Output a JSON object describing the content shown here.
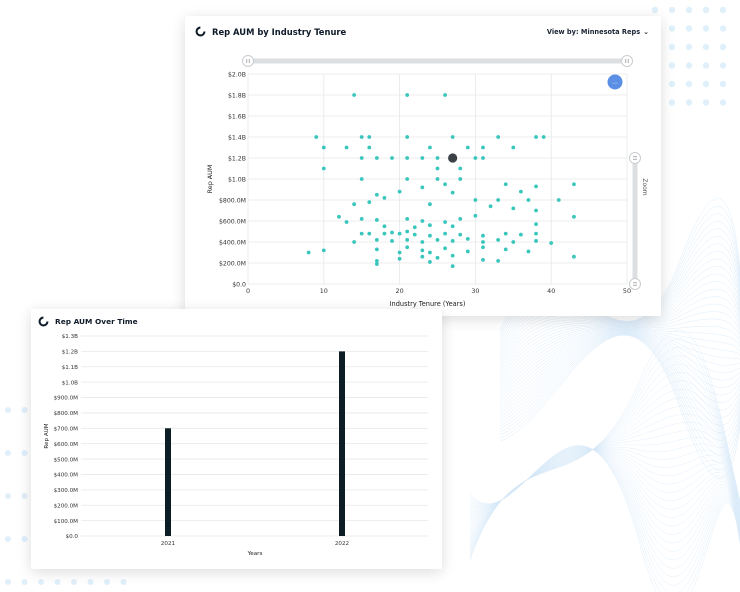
{
  "colors": {
    "scatter_point": "#39c6bc",
    "highlight_point": "#3b4147",
    "bar": "#0c1d26",
    "grid": "#e6e8ea",
    "menu_button": "#5b8fe6",
    "decor_dots": "#e0f0fb"
  },
  "scatter_card": {
    "title": "Rep AUM by Industry Tenure",
    "view_by_label": "View by: Minnesota Reps",
    "zoom_label": "Zoom",
    "menu_icon": "ellipsis-icon"
  },
  "bar_card": {
    "title": "Rep AUM Over Time"
  },
  "chart_data": [
    {
      "type": "scatter",
      "title": "Rep AUM by Industry Tenure",
      "xlabel": "Industry Tenure (Years)",
      "ylabel": "Rep AUM",
      "xlim": [
        0,
        50
      ],
      "ylim": [
        0,
        2000000000
      ],
      "x_ticks": [
        "0",
        "10",
        "20",
        "30",
        "40",
        "50"
      ],
      "y_ticks": [
        "$0.0",
        "$200.0M",
        "$400.0M",
        "$600.0M",
        "$800.0M",
        "$1.0B",
        "$1.2B",
        "$1.4B",
        "$1.6B",
        "$1.8B",
        "$2.0B"
      ],
      "grid": true,
      "highlight": {
        "x": 27,
        "y": 1200000000
      },
      "points": [
        [
          14,
          1800000000
        ],
        [
          21,
          1800000000
        ],
        [
          26,
          1800000000
        ],
        [
          9,
          1400000000
        ],
        [
          15,
          1400000000
        ],
        [
          16,
          1400000000
        ],
        [
          21,
          1400000000
        ],
        [
          27,
          1400000000
        ],
        [
          33,
          1400000000
        ],
        [
          38,
          1400000000
        ],
        [
          39,
          1400000000
        ],
        [
          10,
          1300000000
        ],
        [
          13,
          1300000000
        ],
        [
          16,
          1300000000
        ],
        [
          24,
          1300000000
        ],
        [
          29,
          1300000000
        ],
        [
          31,
          1300000000
        ],
        [
          35,
          1300000000
        ],
        [
          15,
          1200000000
        ],
        [
          17,
          1200000000
        ],
        [
          19,
          1200000000
        ],
        [
          21,
          1200000000
        ],
        [
          23,
          1200000000
        ],
        [
          25,
          1200000000
        ],
        [
          30,
          1200000000
        ],
        [
          31,
          1200000000
        ],
        [
          10,
          1100000000
        ],
        [
          25,
          1100000000
        ],
        [
          28,
          1100000000
        ],
        [
          15,
          1000000000
        ],
        [
          21,
          1000000000
        ],
        [
          25,
          1000000000
        ],
        [
          28,
          1000000000
        ],
        [
          17,
          850000000
        ],
        [
          18,
          820000000
        ],
        [
          23,
          920000000
        ],
        [
          26,
          950000000
        ],
        [
          34,
          950000000
        ],
        [
          38,
          930000000
        ],
        [
          43,
          950000000
        ],
        [
          20,
          880000000
        ],
        [
          27,
          870000000
        ],
        [
          36,
          880000000
        ],
        [
          30,
          800000000
        ],
        [
          33,
          800000000
        ],
        [
          37,
          800000000
        ],
        [
          41,
          800000000
        ],
        [
          14,
          760000000
        ],
        [
          16,
          780000000
        ],
        [
          24,
          760000000
        ],
        [
          32,
          740000000
        ],
        [
          35,
          720000000
        ],
        [
          38,
          700000000
        ],
        [
          12,
          640000000
        ],
        [
          15,
          620000000
        ],
        [
          17,
          610000000
        ],
        [
          21,
          620000000
        ],
        [
          23,
          600000000
        ],
        [
          26,
          590000000
        ],
        [
          28,
          620000000
        ],
        [
          30,
          650000000
        ],
        [
          43,
          640000000
        ],
        [
          13,
          590000000
        ],
        [
          18,
          550000000
        ],
        [
          22,
          540000000
        ],
        [
          24,
          560000000
        ],
        [
          27,
          550000000
        ],
        [
          38,
          570000000
        ],
        [
          15,
          480000000
        ],
        [
          16,
          480000000
        ],
        [
          18,
          480000000
        ],
        [
          19,
          490000000
        ],
        [
          20,
          480000000
        ],
        [
          21,
          500000000
        ],
        [
          22,
          470000000
        ],
        [
          24,
          460000000
        ],
        [
          26,
          480000000
        ],
        [
          28,
          470000000
        ],
        [
          31,
          460000000
        ],
        [
          34,
          480000000
        ],
        [
          36,
          470000000
        ],
        [
          38,
          480000000
        ],
        [
          14,
          400000000
        ],
        [
          17,
          420000000
        ],
        [
          19,
          410000000
        ],
        [
          21,
          420000000
        ],
        [
          23,
          400000000
        ],
        [
          25,
          420000000
        ],
        [
          27,
          410000000
        ],
        [
          29,
          430000000
        ],
        [
          31,
          400000000
        ],
        [
          33,
          420000000
        ],
        [
          35,
          400000000
        ],
        [
          38,
          410000000
        ],
        [
          40,
          390000000
        ],
        [
          8,
          300000000
        ],
        [
          10,
          320000000
        ],
        [
          17,
          330000000
        ],
        [
          20,
          300000000
        ],
        [
          21,
          350000000
        ],
        [
          23,
          320000000
        ],
        [
          24,
          300000000
        ],
        [
          26,
          340000000
        ],
        [
          29,
          310000000
        ],
        [
          31,
          350000000
        ],
        [
          34,
          330000000
        ],
        [
          37,
          310000000
        ],
        [
          17,
          220000000
        ],
        [
          20,
          240000000
        ],
        [
          23,
          260000000
        ],
        [
          25,
          250000000
        ],
        [
          27,
          270000000
        ],
        [
          31,
          230000000
        ],
        [
          33,
          220000000
        ],
        [
          43,
          260000000
        ],
        [
          17,
          190000000
        ],
        [
          24,
          210000000
        ],
        [
          27,
          170000000
        ]
      ]
    },
    {
      "type": "bar",
      "title": "Rep AUM Over Time",
      "xlabel": "Years",
      "ylabel": "Rep AUM",
      "categories": [
        "2021",
        "2022"
      ],
      "values": [
        700000000,
        1200000000
      ],
      "ylim": [
        0,
        1300000000
      ],
      "y_ticks": [
        "$0.0",
        "$100.0M",
        "$200.0M",
        "$300.0M",
        "$400.0M",
        "$500.0M",
        "$600.0M",
        "$700.0M",
        "$800.0M",
        "$900.0M",
        "$1.0B",
        "$1.1B",
        "$1.2B",
        "$1.3B"
      ],
      "grid": true
    }
  ]
}
